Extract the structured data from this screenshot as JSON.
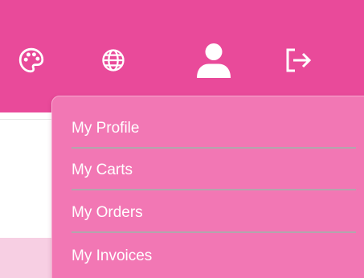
{
  "header": {
    "background_color": "#e94a9a",
    "icons": [
      "palette-icon",
      "globe-icon",
      "user-icon",
      "logout-icon"
    ]
  },
  "user_menu": {
    "background_color": "#f277b4",
    "items": [
      {
        "label": "My Profile"
      },
      {
        "label": "My Carts"
      },
      {
        "label": "My Orders"
      },
      {
        "label": "My Invoices"
      }
    ]
  }
}
